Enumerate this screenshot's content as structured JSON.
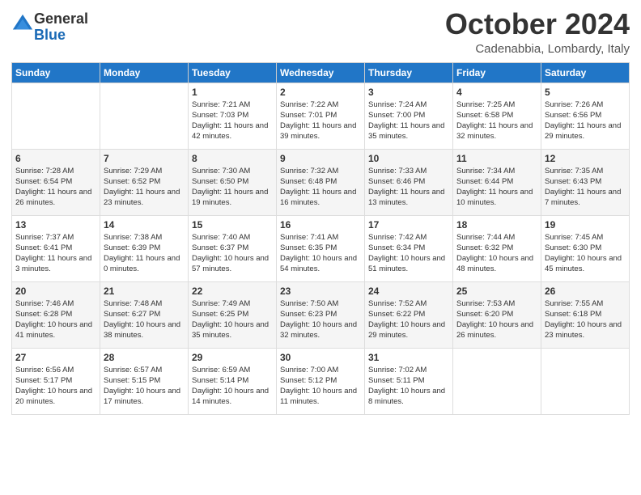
{
  "header": {
    "logo_line1": "General",
    "logo_line2": "Blue",
    "month_title": "October 2024",
    "location": "Cadenabbia, Lombardy, Italy"
  },
  "days_of_week": [
    "Sunday",
    "Monday",
    "Tuesday",
    "Wednesday",
    "Thursday",
    "Friday",
    "Saturday"
  ],
  "weeks": [
    [
      {
        "day": "",
        "info": ""
      },
      {
        "day": "",
        "info": ""
      },
      {
        "day": "1",
        "info": "Sunrise: 7:21 AM\nSunset: 7:03 PM\nDaylight: 11 hours and 42 minutes."
      },
      {
        "day": "2",
        "info": "Sunrise: 7:22 AM\nSunset: 7:01 PM\nDaylight: 11 hours and 39 minutes."
      },
      {
        "day": "3",
        "info": "Sunrise: 7:24 AM\nSunset: 7:00 PM\nDaylight: 11 hours and 35 minutes."
      },
      {
        "day": "4",
        "info": "Sunrise: 7:25 AM\nSunset: 6:58 PM\nDaylight: 11 hours and 32 minutes."
      },
      {
        "day": "5",
        "info": "Sunrise: 7:26 AM\nSunset: 6:56 PM\nDaylight: 11 hours and 29 minutes."
      }
    ],
    [
      {
        "day": "6",
        "info": "Sunrise: 7:28 AM\nSunset: 6:54 PM\nDaylight: 11 hours and 26 minutes."
      },
      {
        "day": "7",
        "info": "Sunrise: 7:29 AM\nSunset: 6:52 PM\nDaylight: 11 hours and 23 minutes."
      },
      {
        "day": "8",
        "info": "Sunrise: 7:30 AM\nSunset: 6:50 PM\nDaylight: 11 hours and 19 minutes."
      },
      {
        "day": "9",
        "info": "Sunrise: 7:32 AM\nSunset: 6:48 PM\nDaylight: 11 hours and 16 minutes."
      },
      {
        "day": "10",
        "info": "Sunrise: 7:33 AM\nSunset: 6:46 PM\nDaylight: 11 hours and 13 minutes."
      },
      {
        "day": "11",
        "info": "Sunrise: 7:34 AM\nSunset: 6:44 PM\nDaylight: 11 hours and 10 minutes."
      },
      {
        "day": "12",
        "info": "Sunrise: 7:35 AM\nSunset: 6:43 PM\nDaylight: 11 hours and 7 minutes."
      }
    ],
    [
      {
        "day": "13",
        "info": "Sunrise: 7:37 AM\nSunset: 6:41 PM\nDaylight: 11 hours and 3 minutes."
      },
      {
        "day": "14",
        "info": "Sunrise: 7:38 AM\nSunset: 6:39 PM\nDaylight: 11 hours and 0 minutes."
      },
      {
        "day": "15",
        "info": "Sunrise: 7:40 AM\nSunset: 6:37 PM\nDaylight: 10 hours and 57 minutes."
      },
      {
        "day": "16",
        "info": "Sunrise: 7:41 AM\nSunset: 6:35 PM\nDaylight: 10 hours and 54 minutes."
      },
      {
        "day": "17",
        "info": "Sunrise: 7:42 AM\nSunset: 6:34 PM\nDaylight: 10 hours and 51 minutes."
      },
      {
        "day": "18",
        "info": "Sunrise: 7:44 AM\nSunset: 6:32 PM\nDaylight: 10 hours and 48 minutes."
      },
      {
        "day": "19",
        "info": "Sunrise: 7:45 AM\nSunset: 6:30 PM\nDaylight: 10 hours and 45 minutes."
      }
    ],
    [
      {
        "day": "20",
        "info": "Sunrise: 7:46 AM\nSunset: 6:28 PM\nDaylight: 10 hours and 41 minutes."
      },
      {
        "day": "21",
        "info": "Sunrise: 7:48 AM\nSunset: 6:27 PM\nDaylight: 10 hours and 38 minutes."
      },
      {
        "day": "22",
        "info": "Sunrise: 7:49 AM\nSunset: 6:25 PM\nDaylight: 10 hours and 35 minutes."
      },
      {
        "day": "23",
        "info": "Sunrise: 7:50 AM\nSunset: 6:23 PM\nDaylight: 10 hours and 32 minutes."
      },
      {
        "day": "24",
        "info": "Sunrise: 7:52 AM\nSunset: 6:22 PM\nDaylight: 10 hours and 29 minutes."
      },
      {
        "day": "25",
        "info": "Sunrise: 7:53 AM\nSunset: 6:20 PM\nDaylight: 10 hours and 26 minutes."
      },
      {
        "day": "26",
        "info": "Sunrise: 7:55 AM\nSunset: 6:18 PM\nDaylight: 10 hours and 23 minutes."
      }
    ],
    [
      {
        "day": "27",
        "info": "Sunrise: 6:56 AM\nSunset: 5:17 PM\nDaylight: 10 hours and 20 minutes."
      },
      {
        "day": "28",
        "info": "Sunrise: 6:57 AM\nSunset: 5:15 PM\nDaylight: 10 hours and 17 minutes."
      },
      {
        "day": "29",
        "info": "Sunrise: 6:59 AM\nSunset: 5:14 PM\nDaylight: 10 hours and 14 minutes."
      },
      {
        "day": "30",
        "info": "Sunrise: 7:00 AM\nSunset: 5:12 PM\nDaylight: 10 hours and 11 minutes."
      },
      {
        "day": "31",
        "info": "Sunrise: 7:02 AM\nSunset: 5:11 PM\nDaylight: 10 hours and 8 minutes."
      },
      {
        "day": "",
        "info": ""
      },
      {
        "day": "",
        "info": ""
      }
    ]
  ]
}
